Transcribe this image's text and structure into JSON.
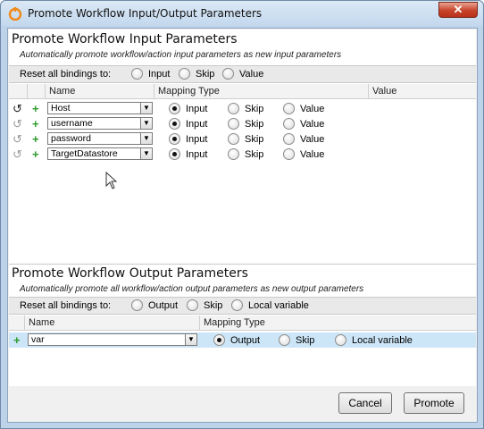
{
  "window": {
    "title": "Promote Workflow Input/Output Parameters"
  },
  "input_section": {
    "title": "Promote Workflow Input Parameters",
    "subtitle": "Automatically promote workflow/action input parameters as new input parameters",
    "reset_label": "Reset all bindings to:",
    "reset_options": [
      "Input",
      "Skip",
      "Value"
    ],
    "columns": [
      "Name",
      "Mapping Type",
      "Value"
    ],
    "mapping_options": [
      "Input",
      "Skip",
      "Value"
    ],
    "rows": [
      {
        "name": "Host",
        "mapping": "Input"
      },
      {
        "name": "username",
        "mapping": "Input"
      },
      {
        "name": "password",
        "mapping": "Input"
      },
      {
        "name": "TargetDatastore",
        "mapping": "Input"
      }
    ]
  },
  "output_section": {
    "title": "Promote Workflow Output Parameters",
    "subtitle": "Automatically promote all workflow/action output parameters as new output parameters",
    "reset_label": "Reset all bindings to:",
    "reset_options": [
      "Output",
      "Skip",
      "Local variable"
    ],
    "columns": [
      "Name",
      "Mapping Type"
    ],
    "mapping_options": [
      "Output",
      "Skip",
      "Local variable"
    ],
    "rows": [
      {
        "name": "var",
        "mapping": "Output"
      }
    ]
  },
  "buttons": {
    "cancel": "Cancel",
    "promote": "Promote"
  },
  "colors": {
    "selected_row": "#cde6f7",
    "add_icon": "#2e9a2e",
    "close_button": "#c8432a"
  }
}
